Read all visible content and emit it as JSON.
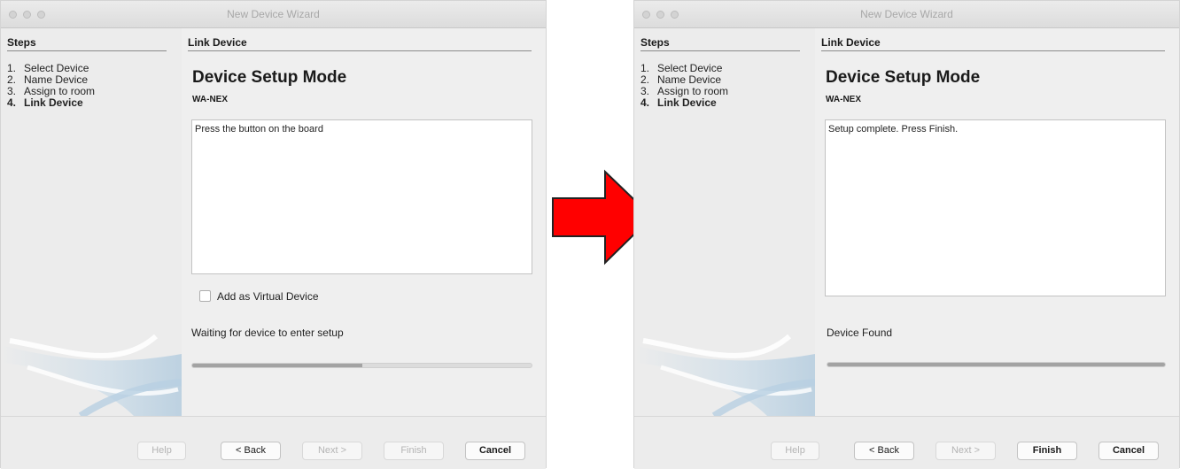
{
  "panels": [
    {
      "window_title": "New Device Wizard",
      "steps_header": "Steps",
      "steps": [
        {
          "num": "1.",
          "label": "Select Device"
        },
        {
          "num": "2.",
          "label": "Name Device"
        },
        {
          "num": "3.",
          "label": "Assign to room"
        },
        {
          "num": "4.",
          "label": "Link Device"
        }
      ],
      "current_step": 4,
      "link_header": "Link Device",
      "setup_title": "Device Setup Mode",
      "device_name": "WA-NEX",
      "message": "Press the button on the board",
      "virtual_checkbox_label": "Add as Virtual Device",
      "virtual_checked": false,
      "status": "Waiting for device to enter setup",
      "progress_fraction": 0.5,
      "buttons": {
        "help": "Help",
        "back": "< Back",
        "next": "Next >",
        "finish": "Finish",
        "cancel": "Cancel"
      },
      "finish_enabled": false
    },
    {
      "window_title": "New Device Wizard",
      "steps_header": "Steps",
      "steps": [
        {
          "num": "1.",
          "label": "Select Device"
        },
        {
          "num": "2.",
          "label": "Name Device"
        },
        {
          "num": "3.",
          "label": "Assign to room"
        },
        {
          "num": "4.",
          "label": "Link Device"
        }
      ],
      "current_step": 4,
      "link_header": "Link Device",
      "setup_title": "Device Setup Mode",
      "device_name": "WA-NEX",
      "message": "Setup complete. Press Finish.",
      "status": "Device Found",
      "progress_fraction": 1.0,
      "buttons": {
        "help": "Help",
        "back": "< Back",
        "next": "Next >",
        "finish": "Finish",
        "cancel": "Cancel"
      },
      "finish_enabled": true
    }
  ],
  "colors": {
    "arrow_fill": "#ff0000",
    "arrow_stroke": "#222222",
    "window_bg": "#ececec"
  }
}
